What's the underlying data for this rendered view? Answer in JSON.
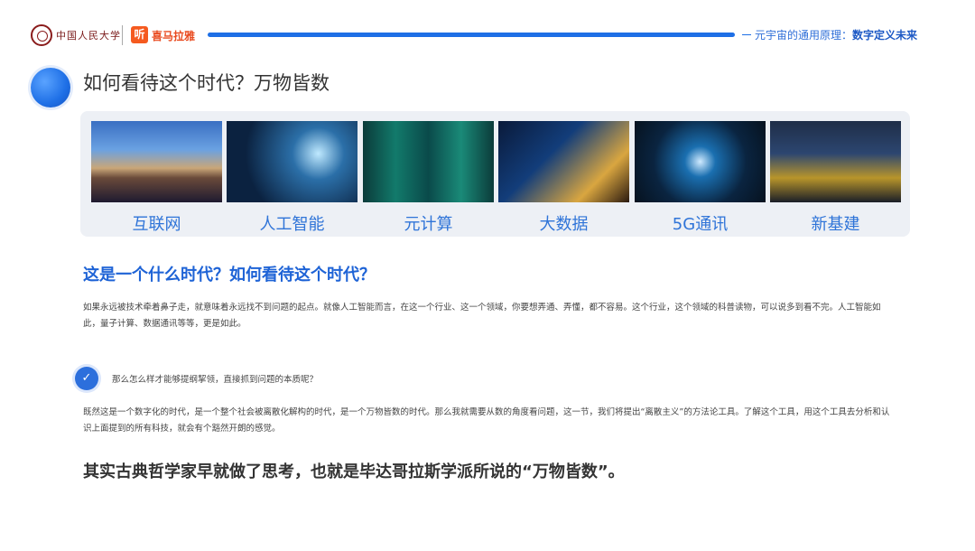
{
  "header": {
    "university_name": "中国人民大学",
    "platform_icon_text": "听",
    "platform_name": "喜马拉雅",
    "course_title_prefix": "元宇宙的通用原理：",
    "course_title_emphasis": "数字定义未来"
  },
  "section": {
    "title": "如何看待这个时代？万物皆数"
  },
  "tiles": [
    {
      "label": "互联网"
    },
    {
      "label": "人工智能"
    },
    {
      "label": "元计算"
    },
    {
      "label": "大数据"
    },
    {
      "label": "5G通讯"
    },
    {
      "label": "新基建"
    }
  ],
  "content": {
    "heading": "这是一个什么时代？如何看待这个时代？",
    "paragraph1": "如果永远被技术牵着鼻子走，就意味着永远找不到问题的起点。就像人工智能而言，在这一个行业、这一个领域，你要想弄通、弄懂，都不容易。这个行业，这个领域的科普读物，可以说多到看不完。人工智能如此，量子计算、数据通讯等等，更是如此。",
    "check_icon": "check-icon",
    "question": "那么怎么样才能够提纲挈领，直接抓到问题的本质呢？",
    "paragraph2": "既然这是一个数字化的时代，是一个整个社会被离散化解构的时代，是一个万物皆数的时代。那么我就需要从数的角度看问题，这一节，我们将提出“离散主义”的方法论工具。了解这个工具，用这个工具去分析和认识上面提到的所有科技，就会有个豁然开朗的感觉。",
    "closing": "其实古典哲学家早就做了思考，也就是毕达哥拉斯学派所说的“万物皆数”。"
  }
}
